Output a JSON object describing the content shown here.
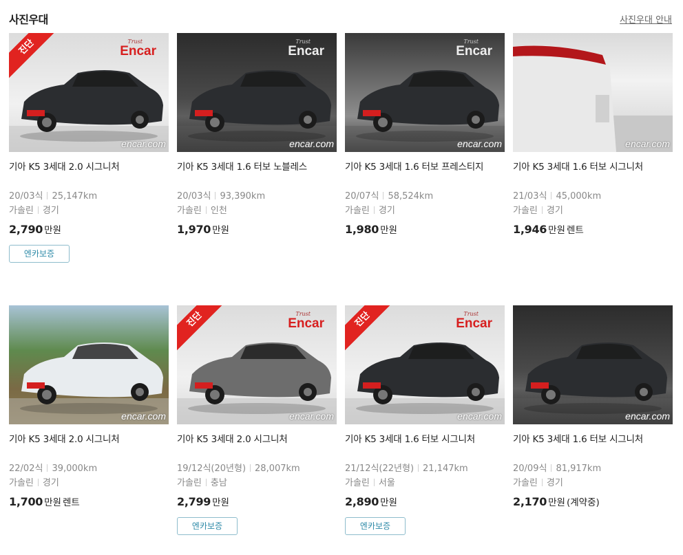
{
  "header": {
    "title": "사진우대",
    "guide_link": "사진우대 안내"
  },
  "watermark": {
    "logo": "Encar",
    "sub": "Trust",
    "foot": "encar.com"
  },
  "diagnosis_ribbon": "진단",
  "colors": {
    "accent_red": "#e12320",
    "badge_border": "#8dbccc",
    "badge_text": "#2e8aa8",
    "meta_gray": "#888888"
  },
  "cars": [
    {
      "name": "기아 K5 3세대 2.0 시그니처",
      "year": "20/03식",
      "mileage": "25,147km",
      "fuel": "가솔린",
      "region": "경기",
      "price": "2,790",
      "unit": "만원",
      "note": "",
      "badge": "엔카보증",
      "diagnosed": true
    },
    {
      "name": "기아 K5 3세대 1.6 터보 노블레스",
      "year": "20/03식",
      "mileage": "93,390km",
      "fuel": "가솔린",
      "region": "인천",
      "price": "1,970",
      "unit": "만원",
      "note": "",
      "badge": "",
      "diagnosed": false
    },
    {
      "name": "기아 K5 3세대 1.6 터보 프레스티지",
      "year": "20/07식",
      "mileage": "58,524km",
      "fuel": "가솔린",
      "region": "경기",
      "price": "1,980",
      "unit": "만원",
      "note": "",
      "badge": "",
      "diagnosed": false
    },
    {
      "name": "기아 K5 3세대 1.6 터보 시그니처",
      "year": "21/03식",
      "mileage": "45,000km",
      "fuel": "가솔린",
      "region": "경기",
      "price": "1,946",
      "unit": "만원",
      "note": "렌트",
      "badge": "",
      "diagnosed": false
    },
    {
      "name": "기아 K5 3세대 2.0 시그니처",
      "year": "22/02식",
      "mileage": "39,000km",
      "fuel": "가솔린",
      "region": "경기",
      "price": "1,700",
      "unit": "만원",
      "note": "렌트",
      "badge": "",
      "diagnosed": false
    },
    {
      "name": "기아 K5 3세대 2.0 시그니처",
      "year": "19/12식(20년형)",
      "mileage": "28,007km",
      "fuel": "가솔린",
      "region": "충남",
      "price": "2,799",
      "unit": "만원",
      "note": "",
      "badge": "엔카보증",
      "diagnosed": true
    },
    {
      "name": "기아 K5 3세대 1.6 터보 시그니처",
      "year": "21/12식(22년형)",
      "mileage": "21,147km",
      "fuel": "가솔린",
      "region": "서울",
      "price": "2,890",
      "unit": "만원",
      "note": "",
      "badge": "엔카보증",
      "diagnosed": true
    },
    {
      "name": "기아 K5 3세대 1.6 터보 시그니처",
      "year": "20/09식",
      "mileage": "81,917km",
      "fuel": "가솔린",
      "region": "경기",
      "price": "2,170",
      "unit": "만원",
      "note": "(계약중)",
      "badge": "",
      "diagnosed": false
    }
  ]
}
